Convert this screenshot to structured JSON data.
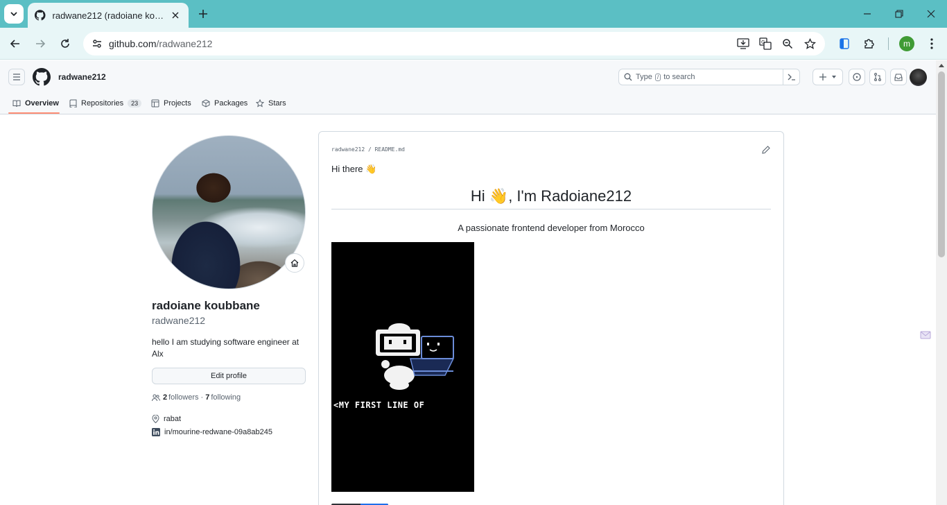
{
  "browser": {
    "tab_title": "radwane212 (radoiane koubbane)",
    "url_domain": "github.com",
    "url_path": "/radwane212",
    "profile_initial": "m",
    "accent_color": "#5bbfc4"
  },
  "github": {
    "context_label": "radwane212",
    "search_prefix": "Type",
    "search_key": "/",
    "search_suffix": "to search",
    "tabs": [
      {
        "label": "Overview",
        "icon": "book-icon"
      },
      {
        "label": "Repositories",
        "count": "23",
        "icon": "repo-icon"
      },
      {
        "label": "Projects",
        "icon": "table-icon"
      },
      {
        "label": "Packages",
        "icon": "package-icon"
      },
      {
        "label": "Stars",
        "icon": "star-icon"
      }
    ],
    "active_tab_color": "#fd8c73"
  },
  "profile": {
    "name": "radoiane koubbane",
    "login": "radwane212",
    "bio": "hello I am studying software engineer at Alx",
    "edit_label": "Edit profile",
    "followers_count": "2",
    "followers_label": "followers",
    "separator": "·",
    "following_count": "7",
    "following_label": "following",
    "location": "rabat",
    "linkedin": "in/mourine-redwane-09a8ab245"
  },
  "readme": {
    "path": "radwane212 / README.md",
    "greeting": "Hi there 👋",
    "heading": "Hi 👋, I'm Radoiane212",
    "tagline": "A passionate frontend developer from Morocco",
    "gif_caption": "<MY FIRST LINE OF"
  }
}
